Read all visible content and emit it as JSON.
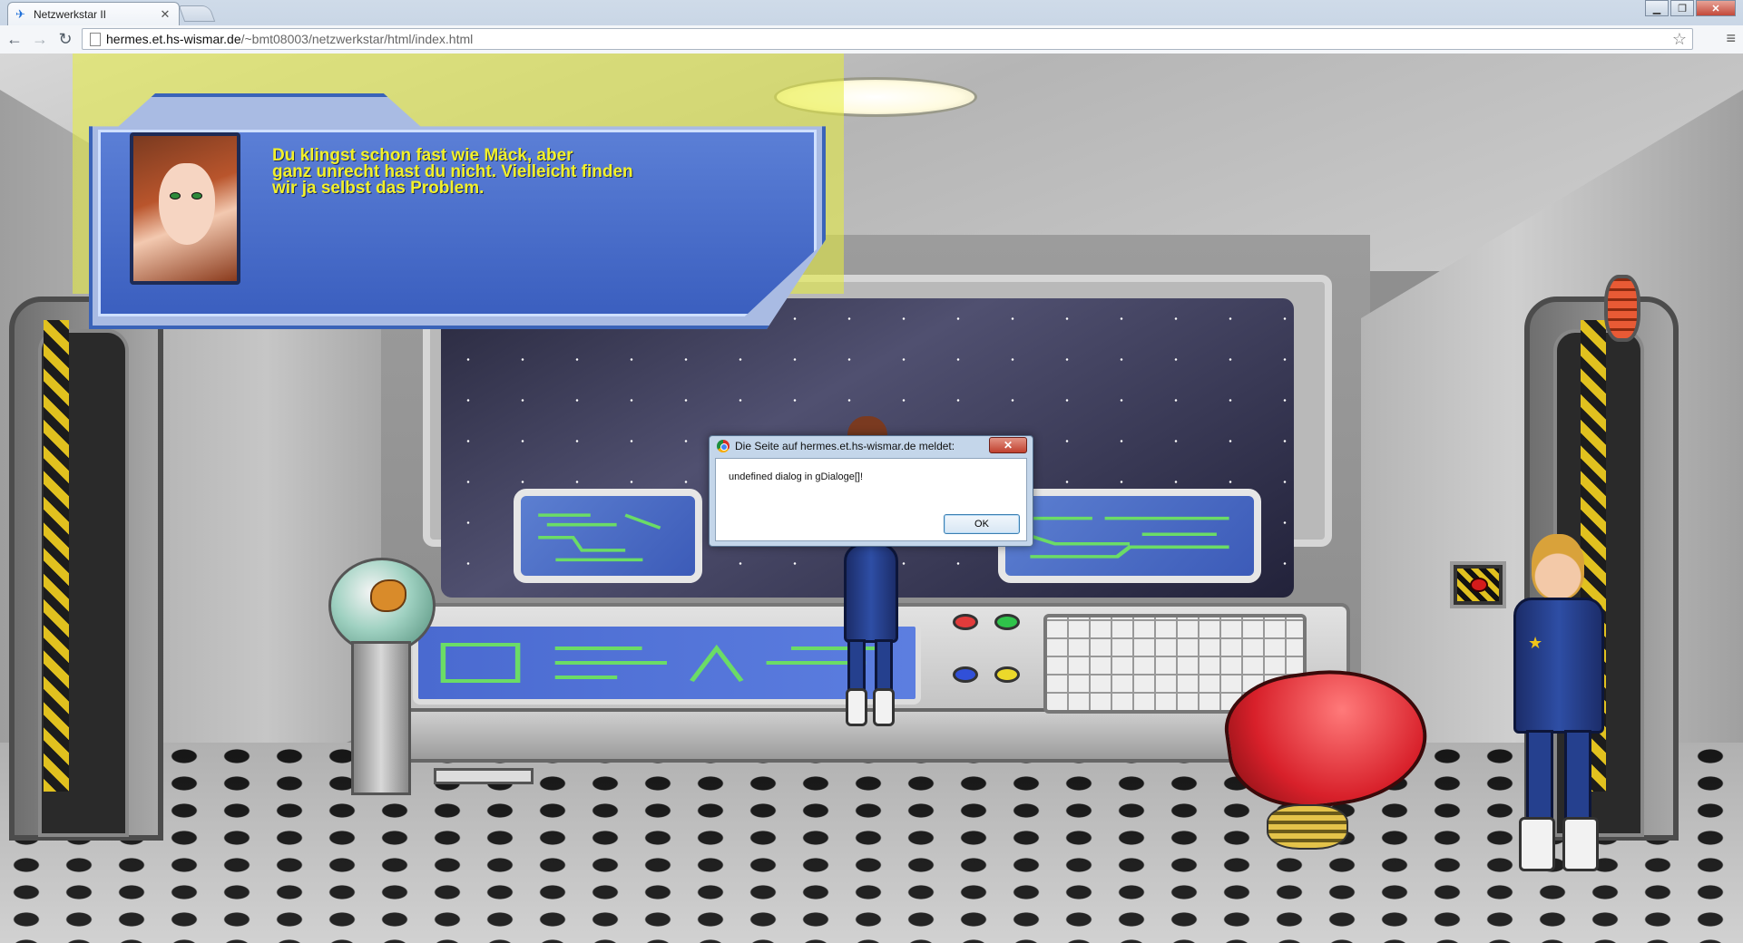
{
  "browser": {
    "tab_title": "Netzwerkstar II",
    "url_host": "hermes.et.hs-wismar.de",
    "url_path": "/~bmt08003/netzwerkstar/html/index.html",
    "icons": [
      "back-arrow-icon",
      "forward-arrow-icon",
      "reload-icon",
      "page-icon",
      "bookmark-star-icon",
      "wrench-menu-icon",
      "minimize-icon",
      "maximize-icon",
      "close-icon"
    ]
  },
  "game": {
    "dialogue": {
      "text": "Du klingst schon fast wie Mäck, aber\nganz unrecht hast du nicht. Vielleicht finden\nwir ja selbst das Problem.",
      "text_color": "#f2f12a",
      "panel_color": "#4a6fcc"
    }
  },
  "alert": {
    "title": "Die Seite auf hermes.et.hs-wismar.de meldet:",
    "message": "undefined dialog in gDialoge[]!",
    "ok_label": "OK"
  }
}
